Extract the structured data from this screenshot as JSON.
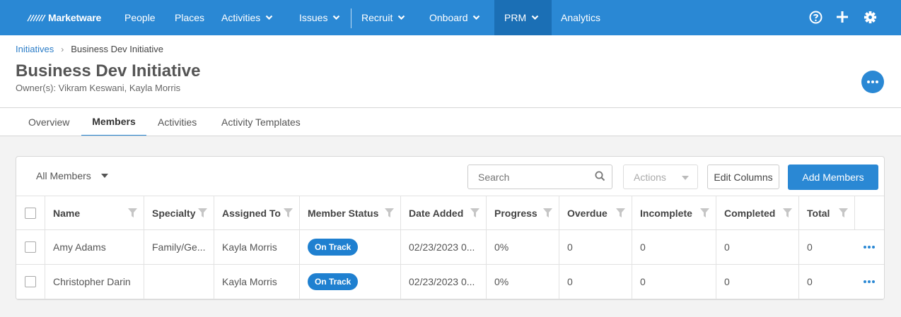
{
  "nav": {
    "brand": "Marketware",
    "items": [
      {
        "label": "People"
      },
      {
        "label": "Places"
      },
      {
        "label": "Activities"
      },
      {
        "label": "Issues"
      },
      {
        "label": "Recruit"
      },
      {
        "label": "Onboard"
      },
      {
        "label": "PRM"
      },
      {
        "label": "Analytics"
      }
    ],
    "active": "PRM",
    "icons": [
      "help-icon",
      "plus-icon",
      "gear-icon"
    ]
  },
  "breadcrumb": {
    "parent": "Initiatives",
    "current": "Business Dev Initiative"
  },
  "page": {
    "title": "Business Dev Initiative",
    "owners": "Owner(s): Vikram Keswani, Kayla Morris"
  },
  "tabs": [
    {
      "label": "Overview"
    },
    {
      "label": "Members"
    },
    {
      "label": "Activities"
    },
    {
      "label": "Activity Templates"
    }
  ],
  "active_tab": "Members",
  "toolbar": {
    "filter": "All Members",
    "search_placeholder": "Search",
    "actions": "Actions",
    "edit_columns": "Edit Columns",
    "add_members": "Add Members"
  },
  "table": {
    "columns": [
      "Name",
      "Specialty",
      "Assigned To",
      "Member Status",
      "Date Added",
      "Progress",
      "Overdue",
      "Incomplete",
      "Completed",
      "Total"
    ],
    "rows": [
      {
        "name": "Amy Adams",
        "specialty": "Family/Ge...",
        "assigned_to": "Kayla Morris",
        "status": "On Track",
        "date_added": "02/23/2023 0...",
        "progress": "0%",
        "overdue": "0",
        "incomplete": "0",
        "completed": "0",
        "total": "0"
      },
      {
        "name": "Christopher Darin",
        "specialty": "",
        "assigned_to": "Kayla Morris",
        "status": "On Track",
        "date_added": "02/23/2023 0...",
        "progress": "0%",
        "overdue": "0",
        "incomplete": "0",
        "completed": "0",
        "total": "0"
      }
    ]
  },
  "colors": {
    "nav_bg": "#2a88d4",
    "nav_active": "#1b6fb5",
    "accent": "#2a88d4",
    "badge": "#1f80d0"
  }
}
